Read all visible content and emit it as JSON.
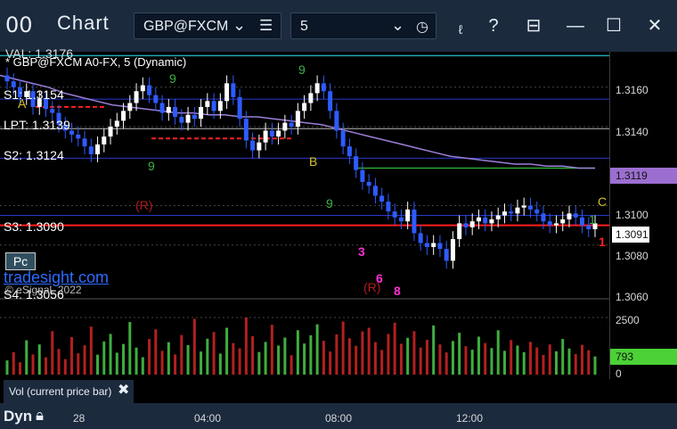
{
  "window": {
    "title": "Chart",
    "symbol": "GBP@FXCM",
    "interval": "5",
    "layout_icon": "list-icon",
    "clock_icon": "clock-icon"
  },
  "chart": {
    "study_header": "VAL: 1.3176",
    "symbol_line": "* GBP@FXCM A0-FX, 5 (Dynamic)",
    "pivot_labels": {
      "s1": "S1: 1.3154",
      "lpt": "LPT: 1.3139",
      "s2": "S2: 1.3124",
      "s3": "S3: 1.3090",
      "s4": "S4: 1.3056"
    },
    "brand": "tradesight.com",
    "copyright": "© eSignal, 2022",
    "pc_button": "Pc",
    "markers": {
      "a": "A",
      "b": "B",
      "c": "C",
      "r1": "(R)",
      "r2": "(R)",
      "three": "3",
      "six": "6",
      "eight": "8",
      "one_red": "1",
      "one_green": "1",
      "nine_a": "9",
      "nine_b": "9",
      "nine_c": "9",
      "nine_d": "9"
    }
  },
  "price_axis": {
    "ticks": [
      "1.3160",
      "1.3140",
      "1.3100",
      "1.3080",
      "1.3060"
    ],
    "highlight_upper": "1.3119",
    "highlight_current": "1.3091",
    "vol_ticks": [
      "2500",
      "0"
    ],
    "vol_current": "793",
    "colors": {
      "purple_box": "#9b6fd0",
      "green_box": "#4cd137"
    }
  },
  "vol_panel": {
    "label": "Vol (current price bar)",
    "close_icon": "close-icon"
  },
  "bottom": {
    "mode": "Dyn",
    "time_labels": [
      "28",
      "04:00",
      "08:00",
      "12:00"
    ]
  },
  "chart_data": {
    "type": "candlestick",
    "symbol": "GBP@FXCM",
    "y_range": [
      1.3055,
      1.3178
    ],
    "close_approx": [
      1.3163,
      1.316,
      1.3155,
      1.3158,
      1.315,
      1.3154,
      1.3149,
      1.3147,
      1.3141,
      1.3138,
      1.3136,
      1.3134,
      1.313,
      1.3126,
      1.3131,
      1.3135,
      1.314,
      1.3143,
      1.3148,
      1.3152,
      1.3158,
      1.3161,
      1.3156,
      1.3152,
      1.3147,
      1.315,
      1.3145,
      1.3142,
      1.3146,
      1.3144,
      1.315,
      1.3153,
      1.3148,
      1.3153,
      1.3162,
      1.3155,
      1.3144,
      1.3133,
      1.3128,
      1.3132,
      1.3138,
      1.3135,
      1.3138,
      1.3142,
      1.314,
      1.3148,
      1.3152,
      1.3157,
      1.3162,
      1.3158,
      1.3148,
      1.3138,
      1.313,
      1.3125,
      1.3118,
      1.3112,
      1.311,
      1.3105,
      1.3102,
      1.3097,
      1.3094,
      1.3092,
      1.3098,
      1.3086,
      1.3081,
      1.3079,
      1.3081,
      1.3078,
      1.3072,
      1.3083,
      1.3091,
      1.3089,
      1.3092,
      1.3094,
      1.3091,
      1.3093,
      1.3095,
      1.3097,
      1.3096,
      1.3099,
      1.31,
      1.3098,
      1.3096,
      1.3092,
      1.309,
      1.3091,
      1.3093,
      1.3096,
      1.3094,
      1.309,
      1.3088,
      1.3091
    ],
    "volume_approx": [
      620,
      980,
      540,
      1500,
      880,
      1320,
      760,
      1900,
      1120,
      680,
      1640,
      930,
      1280,
      2100,
      870,
      1450,
      1780,
      960,
      1340,
      2300,
      1180,
      760,
      1560,
      1980,
      1040,
      1420,
      880,
      1730,
      1290,
      2440,
      1010,
      1570,
      1860,
      920,
      2050,
      1380,
      1150,
      2500,
      1680,
      990,
      1430,
      2180,
      1270,
      1620,
      850,
      1940,
      1360,
      1720,
      2200,
      1480,
      1010,
      1760,
      2320,
      1590,
      1260,
      1890,
      2050,
      1420,
      1080,
      1780,
      2270,
      1350,
      1610,
      1900,
      1180,
      1520,
      2150,
      1320,
      970,
      1470,
      1830,
      1240,
      1090,
      1660,
      1380,
      1160,
      1940,
      1040,
      1510,
      1270,
      980,
      1430,
      1190,
      860,
      1320,
      1020,
      1560,
      1140,
      900,
      1300,
      1070,
      793
    ],
    "vol_y_range": [
      0,
      3200
    ],
    "ma_approx": [
      1.3166,
      1.3164,
      1.3162,
      1.316,
      1.3157,
      1.3155,
      1.3153,
      1.3151,
      1.315,
      1.3149,
      1.3148,
      1.3147,
      1.3147,
      1.3146,
      1.3146,
      1.3145,
      1.3145,
      1.3144,
      1.3143,
      1.3142,
      1.3141,
      1.3139,
      1.3137,
      1.3135,
      1.3133,
      1.3131,
      1.3129,
      1.3127,
      1.3125,
      1.3124,
      1.3123,
      1.3122,
      1.3121,
      1.3121,
      1.312,
      1.312,
      1.3119,
      1.3119
    ]
  }
}
